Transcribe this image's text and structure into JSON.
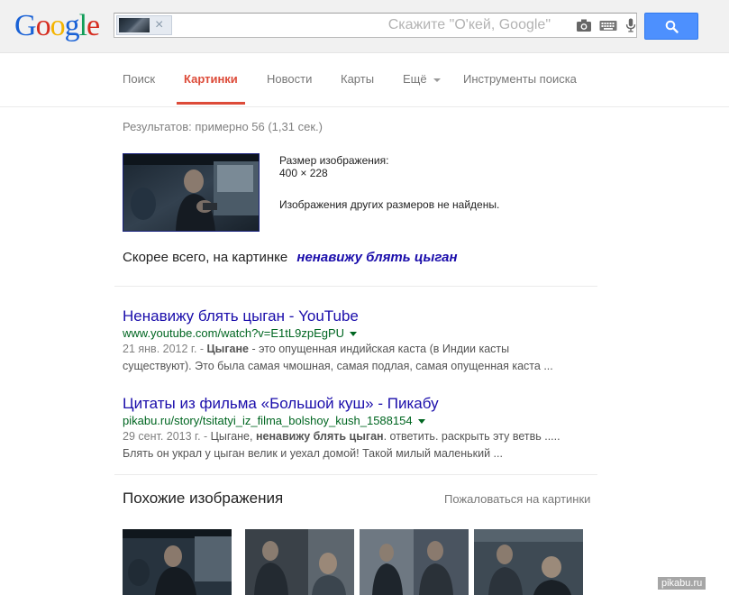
{
  "header": {
    "logo_letters": [
      "G",
      "o",
      "o",
      "g",
      "l",
      "e"
    ],
    "logo_colors": [
      "#1a62d6",
      "#d62d20",
      "#f4b400",
      "#1a62d6",
      "#109d58",
      "#d62d20"
    ],
    "search_placeholder": "Скажите \"О'кей, Google\"",
    "chip_close": "×"
  },
  "nav": {
    "items": [
      {
        "label": "Поиск",
        "active": false
      },
      {
        "label": "Картинки",
        "active": true
      },
      {
        "label": "Новости",
        "active": false
      },
      {
        "label": "Карты",
        "active": false
      },
      {
        "label": "Ещё",
        "active": false
      },
      {
        "label": "Инструменты поиска",
        "active": false
      }
    ]
  },
  "stats": "Результатов: примерно 56 (1,31 сек.)",
  "query_image": {
    "size_label": "Размер изображения:",
    "size_value": "400 × 228",
    "no_other_sizes": "Изображения других размеров не найдены."
  },
  "best_guess": {
    "prefix": "Скорее всего, на картинке",
    "query": "ненавижу блять цыган"
  },
  "results": [
    {
      "title": "Ненавижу блять цыган - YouTube",
      "url": "www.youtube.com/watch?v=E1tL9zpEgPU",
      "date": "21 янв. 2012 г. - ",
      "snippet_bold": "Цыгане",
      "snippet_rest": " - это опущенная индийская каста (в Индии касты",
      "snippet_line2": "существуют). Это была самая чмошная, самая подлая, самая опущенная каста ..."
    },
    {
      "title": "Цитаты из фильма «Большой куш» - Пикабу",
      "url": "pikabu.ru/story/tsitatyi_iz_filma_bolshoy_kush_1588154",
      "date": "29 сент. 2013 г. - ",
      "snippet_pre": "Цыгане, ",
      "snippet_bold": "ненавижу блять цыган",
      "snippet_rest": ". ответить. раскрыть эту ветвь .....",
      "snippet_line2": "Блять он украл у цыган велик и уехал домой! Такой милый маленький ..."
    }
  ],
  "similar": {
    "title": "Похожие изображения",
    "report": "Пожаловаться на картинки"
  },
  "watermark": "pikabu.ru"
}
